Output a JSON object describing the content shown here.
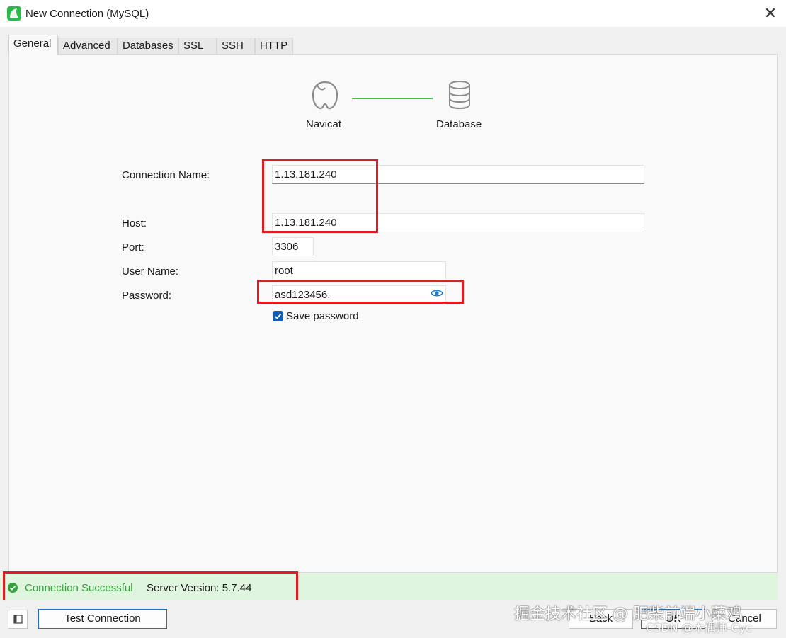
{
  "window": {
    "title": "New Connection (MySQL)",
    "close_glyph": "✕"
  },
  "tabs": [
    {
      "label": "General",
      "active": true
    },
    {
      "label": "Advanced"
    },
    {
      "label": "Databases"
    },
    {
      "label": "SSL"
    },
    {
      "label": "SSH"
    },
    {
      "label": "HTTP"
    }
  ],
  "diagram": {
    "left_label": "Navicat",
    "right_label": "Database",
    "left_icon": "navicat-icon",
    "right_icon": "database-icon",
    "line_color": "#4cbb4c"
  },
  "form": {
    "connection_name": {
      "label": "Connection Name:",
      "value": "1.13.181.240"
    },
    "host": {
      "label": "Host:",
      "value": "1.13.181.240"
    },
    "port": {
      "label": "Port:",
      "value": "3306"
    },
    "user_name": {
      "label": "User Name:",
      "value": "root"
    },
    "password": {
      "label": "Password:",
      "value": "asd123456."
    },
    "save_password": {
      "label": "Save password",
      "checked": true
    }
  },
  "status": {
    "message": "Connection Successful",
    "server_version": "Server Version: 5.7.44",
    "color": "#33a33a"
  },
  "buttons": {
    "test_connection": "Test Connection",
    "back": "Back",
    "ok": "OK",
    "cancel": "Cancel"
  },
  "watermarks": {
    "primary": "掘金技术社区 @ 肥柴前端小菜鸡",
    "secondary": "CSDN @木偶师-Cyc"
  },
  "colors": {
    "highlight": "#e11b22",
    "accent": "#0f5fb5"
  }
}
